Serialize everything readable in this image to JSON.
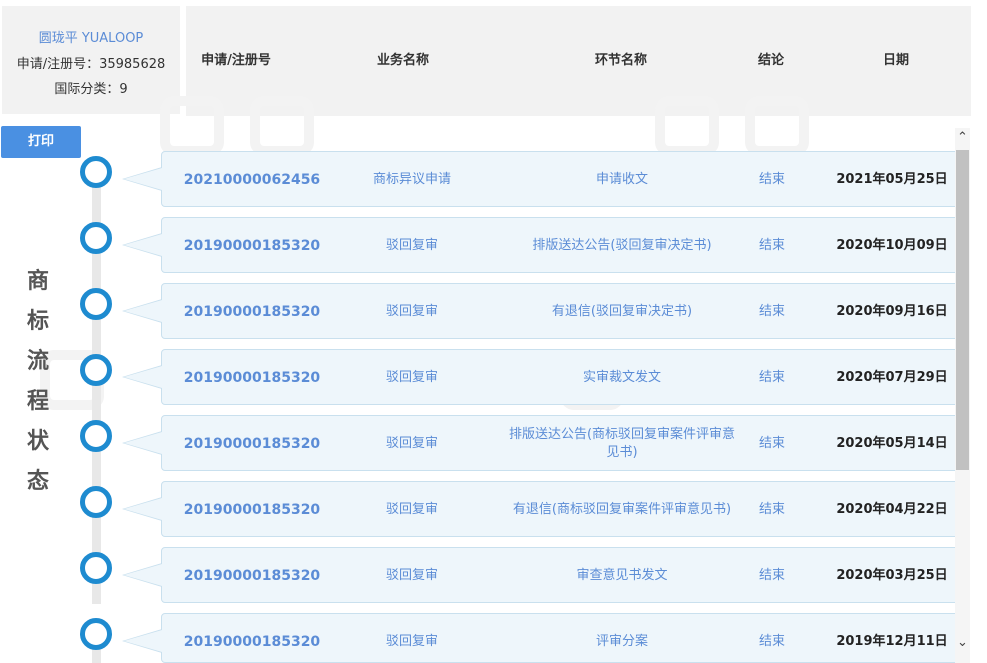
{
  "trademark": {
    "name": "圆珑平 YUALOOP",
    "reg_label": "申请/注册号：35985628",
    "class_label": "国际分类：9"
  },
  "columns": {
    "reg_no": "申请/注册号",
    "business": "业务名称",
    "stage": "环节名称",
    "conclusion": "结论",
    "date": "日期"
  },
  "print_label": "打印",
  "side_title": [
    "商",
    "标",
    "流",
    "程",
    "状",
    "态"
  ],
  "rows": [
    {
      "reg_no": "20210000062456",
      "business": "商标异议申请",
      "stage": "申请收文",
      "conclusion": "结束",
      "date": "2021年05月25日"
    },
    {
      "reg_no": "20190000185320",
      "business": "驳回复审",
      "stage": "排版送达公告(驳回复审决定书)",
      "conclusion": "结束",
      "date": "2020年10月09日"
    },
    {
      "reg_no": "20190000185320",
      "business": "驳回复审",
      "stage": "有退信(驳回复审决定书)",
      "conclusion": "结束",
      "date": "2020年09月16日"
    },
    {
      "reg_no": "20190000185320",
      "business": "驳回复审",
      "stage": "实审裁文发文",
      "conclusion": "结束",
      "date": "2020年07月29日"
    },
    {
      "reg_no": "20190000185320",
      "business": "驳回复审",
      "stage": "排版送达公告(商标驳回复审案件评审意见书)",
      "conclusion": "结束",
      "date": "2020年05月14日"
    },
    {
      "reg_no": "20190000185320",
      "business": "驳回复审",
      "stage": "有退信(商标驳回复审案件评审意见书)",
      "conclusion": "结束",
      "date": "2020年04月22日"
    },
    {
      "reg_no": "20190000185320",
      "business": "驳回复审",
      "stage": "审查意见书发文",
      "conclusion": "结束",
      "date": "2020年03月25日"
    },
    {
      "reg_no": "20190000185320",
      "business": "驳回复审",
      "stage": "评审分案",
      "conclusion": "结束",
      "date": "2019年12月11日"
    }
  ],
  "colors": {
    "accent": "#1e8bd0",
    "link": "#5b8cd6",
    "button": "#4a90e2",
    "row_bg": "#eef6fb",
    "header_bg": "#f2f2f2"
  },
  "icons": {
    "scroll_up": "chevron-up-icon",
    "scroll_down": "chevron-down-icon"
  }
}
